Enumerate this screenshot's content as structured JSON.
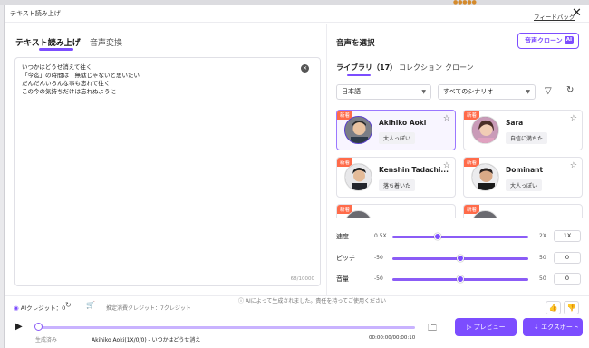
{
  "window": {
    "title": "テキスト読み上げ",
    "feedback": "フィードバック",
    "close": "✕"
  },
  "left": {
    "tabs": [
      "テキスト読み上げ",
      "音声変換"
    ],
    "text_lines": [
      "いつかはどうせ消えて往く",
      "「今迄」の時間は　無駄じゃないと思いたい",
      "だんだんいろんな事も忘れて往く",
      "この今の気持ちだけは忘れぬように"
    ],
    "char_count": "68/10000"
  },
  "right": {
    "title": "音声を選択",
    "clone_button": "音声クローン",
    "clone_ai": "AI",
    "tabs": [
      {
        "label": "ライブラリ（17）"
      },
      {
        "label": "コレクション"
      },
      {
        "label": "クローン"
      }
    ],
    "language": "日本語",
    "scenario": "すべてのシナリオ",
    "voices": [
      {
        "badge": "新着",
        "name": "Akihiko Aoki",
        "tag": "大人っぽい"
      },
      {
        "badge": "新着",
        "name": "Sara",
        "tag": "自信に満ちた"
      },
      {
        "badge": "新着",
        "name": "Kenshin Tadachi...",
        "tag": "落ち着いた"
      },
      {
        "badge": "新着",
        "name": "Dominant",
        "tag": "大人っぽい"
      },
      {
        "badge": "新着",
        "name": "",
        "tag": ""
      },
      {
        "badge": "新着",
        "name": "",
        "tag": ""
      }
    ],
    "sliders": [
      {
        "label": "速度",
        "min": "0.5X",
        "max": "2X",
        "value": "1X",
        "fraction": 0.33
      },
      {
        "label": "ピッチ",
        "min": "-50",
        "max": "50",
        "value": "0",
        "fraction": 0.5
      },
      {
        "label": "音量",
        "min": "-50",
        "max": "50",
        "value": "0",
        "fraction": 0.5
      }
    ]
  },
  "bottom": {
    "notice": "AIによって生成されました。責任を持ってご使用ください",
    "ai_credit": "AIクレジット：0",
    "estimate": "推定消費クレジット：7クレジット",
    "generated": "生成済み",
    "file_name": "Akihiko Aoki(1X/0/0) - いつかはどうせ消えて往く...",
    "time": "00:00:00/00:00:10",
    "preview": "プレビュー",
    "export": "エクスポート"
  }
}
